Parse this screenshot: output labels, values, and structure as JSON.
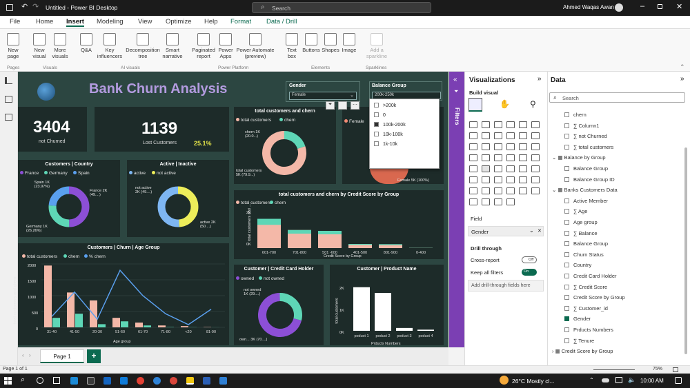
{
  "window": {
    "title": "Untitled - Power BI Desktop",
    "search": "Search",
    "user": "Ahmed Waqas Awan"
  },
  "tabs": [
    "File",
    "Home",
    "Insert",
    "Modeling",
    "View",
    "Optimize",
    "Help",
    "Format",
    "Data / Drill"
  ],
  "ribbon": {
    "btns": [
      "New page",
      "New visual",
      "More visuals",
      "Q&A",
      "Key influencers",
      "Decomposition tree",
      "Smart narrative",
      "Paginated report",
      "Power Apps",
      "Power Automate (preview)",
      "Text box",
      "Buttons",
      "Shapes",
      "Image",
      "Add a sparkline"
    ],
    "groups": [
      "Pages",
      "Visuals",
      "AI visuals",
      "Power Platform",
      "Elements",
      "Sparklines"
    ]
  },
  "report": {
    "title": "Bank Churn Analysis",
    "kpi1": {
      "value": "3404",
      "label": "not Churned"
    },
    "kpi2": {
      "value": "1139",
      "label": "Lost Customers",
      "pct": "25.1%"
    },
    "gender": {
      "title": "Gender",
      "value": "Female"
    },
    "balance": {
      "title": "Balance Group",
      "selected": "200k-250k",
      "options": [
        ">200k",
        "0",
        "100k-200k",
        "10k-100k",
        "1k-10k"
      ]
    },
    "female_label": "Female 5K (100%)",
    "country": {
      "title": "Customers | Country",
      "legend": [
        "France",
        "Germany",
        "Spain"
      ],
      "labels": [
        "Spain 1K (23.97%)",
        "France 2K (49....)",
        "Germany 1K (26.26%)"
      ]
    },
    "active": {
      "title": "Active | Inactive",
      "legend": [
        "active",
        "not active"
      ],
      "labels": [
        "not active 2K (49....)",
        "active 2K (50....)"
      ]
    },
    "chern": {
      "title": "total customers and chern",
      "legend": [
        "total customers",
        "chern"
      ],
      "labels": [
        "chern 1K (20.0...)",
        "total customers 5K (79.9...)"
      ]
    },
    "credit": {
      "title": "total customers and chern by Credit Score by Group",
      "legend": [
        "total customers",
        "chern"
      ],
      "xlabel": "Credit Score by Group",
      "ylabel": "total customers and ...",
      "yticks": [
        "2K",
        "0K"
      ]
    },
    "age": {
      "title": "Customers | Churn | Age Group",
      "legend": [
        "total customers",
        "chern",
        "% chern"
      ],
      "xlabel": "Age group",
      "ylabel": "total customers and chern",
      "yticks": [
        "2000",
        "1500",
        "1000",
        "500",
        "0"
      ]
    },
    "cch": {
      "title": "Customer | Credit Card Holder",
      "legend": [
        "owned",
        "not owned"
      ],
      "labels": [
        "not owned 1K (29....)",
        "own... 3K (70....)"
      ]
    },
    "product": {
      "title": "Customer | Product Name",
      "xlabel": "Prducts Numbers",
      "ylabel": "total customers",
      "yticks": [
        "2K",
        "1K",
        "0K"
      ]
    }
  },
  "chart_data": [
    {
      "type": "bar",
      "title": "total customers and chern by Credit Score by Group",
      "categories": [
        "601-700",
        "701-800",
        "501 -600",
        "401-500",
        "801-900",
        "0-400"
      ],
      "series": [
        {
          "name": "total customers",
          "values": [
            3400,
            2100,
            2000,
            480,
            450,
            20
          ]
        },
        {
          "name": "chern",
          "values": [
            700,
            420,
            400,
            100,
            110,
            20
          ]
        }
      ],
      "xlabel": "Credit Score by Group",
      "ylabel": "total customers and ..."
    },
    {
      "type": "bar",
      "title": "Customers | Churn | Age Group",
      "categories": [
        "31-40",
        "41-50",
        "20-30",
        "51-60",
        "61-70",
        "71-80",
        "<20",
        "81-90"
      ],
      "series": [
        {
          "name": "total customers",
          "values": [
            1950,
            1100,
            850,
            300,
            150,
            60,
            40,
            10
          ]
        },
        {
          "name": "chern",
          "values": [
            300,
            430,
            100,
            190,
            60,
            10,
            5,
            2
          ]
        },
        {
          "name": "% chern",
          "values": [
            12,
            39,
            9,
            63,
            35,
            15,
            3,
            20
          ]
        }
      ],
      "ylim": [
        0,
        2000
      ],
      "xlabel": "Age group",
      "ylabel": "total customers and chern"
    },
    {
      "type": "bar",
      "title": "Customer | Product Name",
      "categories": [
        "poduct 1",
        "poduct 2",
        "poduct 3",
        "poduct 4"
      ],
      "values": [
        2300,
        2000,
        150,
        60
      ],
      "xlabel": "Prducts Numbers",
      "ylabel": "total customers"
    },
    {
      "type": "pie",
      "title": "Customers | Country",
      "categories": [
        "France",
        "Germany",
        "Spain"
      ],
      "values": [
        49.9,
        26.26,
        23.97
      ]
    },
    {
      "type": "pie",
      "title": "Active | Inactive",
      "categories": [
        "not active",
        "active"
      ],
      "values": [
        49,
        51
      ]
    },
    {
      "type": "pie",
      "title": "total customers and chern",
      "categories": [
        "total customers",
        "chern"
      ],
      "values": [
        79.9,
        20.0
      ]
    },
    {
      "type": "pie",
      "title": "Customer | Credit Card Holder",
      "categories": [
        "owned",
        "not owned"
      ],
      "values": [
        70,
        29
      ]
    }
  ],
  "viz": {
    "title": "Visualizations",
    "build": "Build visual",
    "field": "Field",
    "field_value": "Gender",
    "drill": "Drill through",
    "cross": "Cross-report",
    "cross_state": "Off",
    "keep": "Keep all filters",
    "keep_state": "On",
    "add": "Add drill-through fields here"
  },
  "filters": "Filters",
  "data": {
    "title": "Data",
    "search": "Search",
    "items": [
      "chern",
      "Column1",
      "not Churned",
      "total customers",
      "Balance by Group",
      "Balance Group",
      "Balance Group ID",
      "Banks Customers Data",
      "Active Member",
      "Age",
      "Age group",
      "Balance",
      "Balance Group",
      "Churn Status",
      "Country",
      "Credit Card Holder",
      "Credit Score",
      "Credit Score by Group",
      "Customer_id",
      "Gender",
      "Prducts Numbers",
      "Tenure",
      "Credit Score by Group"
    ]
  },
  "page": {
    "tab": "Page 1",
    "add": "+",
    "status": "Page 1 of 1",
    "zoom": "75%"
  },
  "taskbar": {
    "weather": "26°C  Mostly cl...",
    "time": "10:00 AM",
    "search": "Search"
  }
}
